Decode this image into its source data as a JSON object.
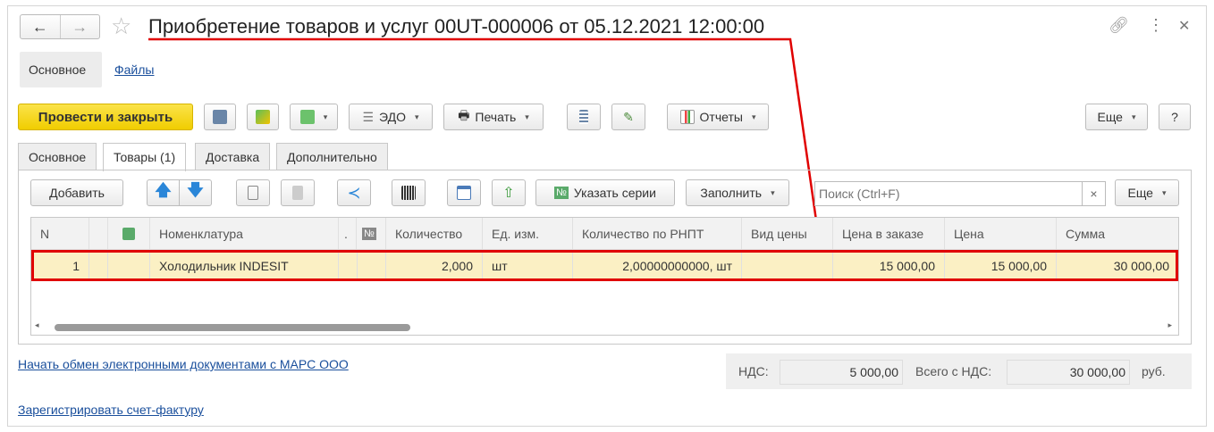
{
  "window": {
    "title": "Приобретение товаров и услуг 00UT-000006 от 05.12.2021 12:00:00"
  },
  "nav": {
    "back": "←",
    "forward": "→"
  },
  "links_top": {
    "main": "Основное",
    "files": "Файлы"
  },
  "toolbar": {
    "post_close": "Провести и закрыть",
    "edo": "ЭДО",
    "print": "Печать",
    "reports": "Отчеты",
    "more": "Еще",
    "help": "?"
  },
  "tabs": [
    "Основное",
    "Товары (1)",
    "Доставка",
    "Дополнительно"
  ],
  "table_toolbar": {
    "add": "Добавить",
    "series": "Указать серии",
    "fill": "Заполнить",
    "search_placeholder": "Поиск (Ctrl+F)",
    "clear": "×",
    "more": "Еще"
  },
  "table": {
    "headers": [
      "N",
      "",
      "",
      "Номенклатура",
      ".",
      "№",
      "Количество",
      "Ед. изм.",
      "Количество по РНПТ",
      "Вид цены",
      "Цена в заказе",
      "Цена",
      "Сумма"
    ],
    "rows": [
      [
        "1",
        "",
        "",
        "Холодильник INDESIT",
        "",
        "",
        "2,000",
        "шт",
        "2,00000000000, шт",
        "",
        "15 000,00",
        "15 000,00",
        "30 000,00"
      ]
    ]
  },
  "footer": {
    "edo_link": "Начать обмен электронными документами с МАРС ООО",
    "invoice_link": "Зарегистрировать счет-фактуру",
    "vat_label": "НДС:",
    "vat_value": "5 000,00",
    "total_label": "Всего с НДС:",
    "total_value": "30 000,00",
    "currency": "руб."
  },
  "colors": {
    "primary": "#f7d61c",
    "highlight": "#fbf0c4",
    "annotation": "#e00000"
  }
}
